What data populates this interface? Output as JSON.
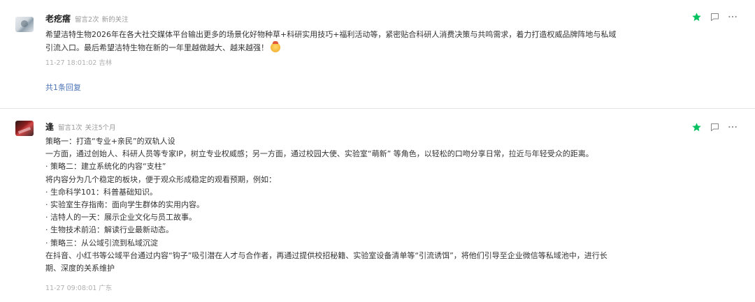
{
  "comments": [
    {
      "nickname": "老疙瘩",
      "stats": "留言2次",
      "follow": "新的关注",
      "lines": [
        "希望洁特生物2026年在各大社交媒体平台输出更多的场景化好物种草+科研实用技巧+福利活动等，紧密贴合科研人消费决策与共鸣需求，着力打造权威品牌阵地与私域",
        "引流入口。最后希望洁特生物在新的一年里越做越大、越来越强！"
      ],
      "time": "11-27 18:01:02 吉林",
      "replies": "共1条回复",
      "starred": true
    },
    {
      "nickname": "逢",
      "stats": "留言1次",
      "follow": "关注5个月",
      "lines": [
        "策略一：打造“专业+亲民”的双轨人设",
        " 一方面，通过创始人、科研人员等专家IP，树立专业权威感；另一方面，通过校园大使、实验室“萌新” 等角色，以轻松的口吻分享日常，拉近与年轻受众的距离。",
        "· 策略二：建立系统化的内容“支柱”",
        " 将内容分为几个稳定的板块，便于观众形成稳定的观看预期，例如：",
        " · 生命科学101：科普基础知识。",
        " · 实验室生存指南：面向学生群体的实用内容。",
        " · 洁特人的一天：展示企业文化与员工故事。",
        " · 生物技术前沿：解读行业最新动态。",
        "· 策略三：从公域引流到私域沉淀",
        " 在抖音、小红书等公域平台通过内容“钩子”吸引潜在人才与合作者，再通过提供校招秘籍、实验室设备清单等“引流诱饵”，将他们引导至企业微信等私域池中，进行长",
        "期、深度的关系维护"
      ],
      "time": "11-27 09:08:01 广东",
      "starred": true
    }
  ],
  "icons": {
    "star": "star-icon",
    "comment": "comment-icon",
    "more": "more-icon"
  },
  "colors": {
    "star": "#07c160",
    "link": "#4c74b8",
    "muted": "#999999"
  }
}
